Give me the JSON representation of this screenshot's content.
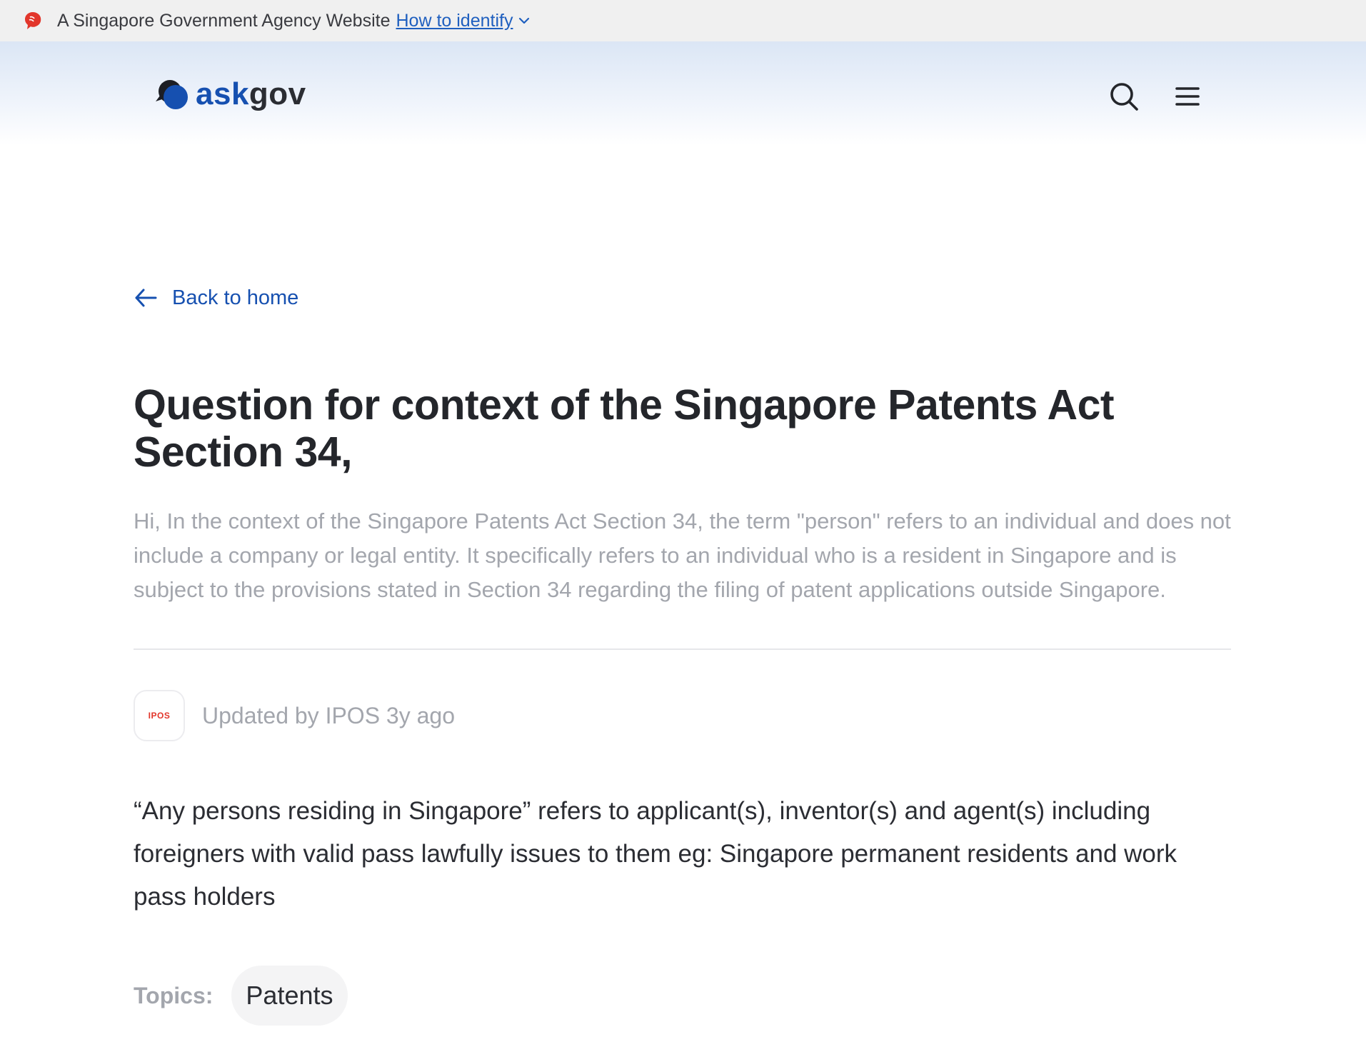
{
  "masthead": {
    "text": "A Singapore Government Agency Website",
    "link_label": "How to identify"
  },
  "header": {
    "logo_part1": "ask",
    "logo_part2": "gov",
    "icons": [
      "search-icon",
      "menu-icon"
    ]
  },
  "nav": {
    "back_label": "Back to home"
  },
  "question": {
    "title": "Question for context of the Singapore Patents Act Section 34,",
    "summary": "Hi, In the context of the Singapore Patents Act Section 34, the term \"person\" refers to an individual and does not include a company or legal entity. It specifically refers to an individual who is a resident in Singapore and is subject to the provisions stated in Section 34 regarding the filing of patent applications outside Singapore."
  },
  "meta": {
    "avatar_label": "IPOS",
    "updated_text": "Updated by IPOS 3y ago"
  },
  "answer": {
    "text": "“Any persons residing in Singapore” refers to applicant(s), inventor(s) and agent(s) in­cluding foreigners with valid pass lawfully issues to them eg: Singapore permanent resi­dents and work pass holders"
  },
  "topics": {
    "label": "Topics:",
    "items": [
      "Patents"
    ]
  },
  "colors": {
    "brand_blue": "#1650b0",
    "link_blue": "#1f5fbf",
    "lion_red": "#e2362b",
    "muted_text": "#a3a6ad"
  }
}
